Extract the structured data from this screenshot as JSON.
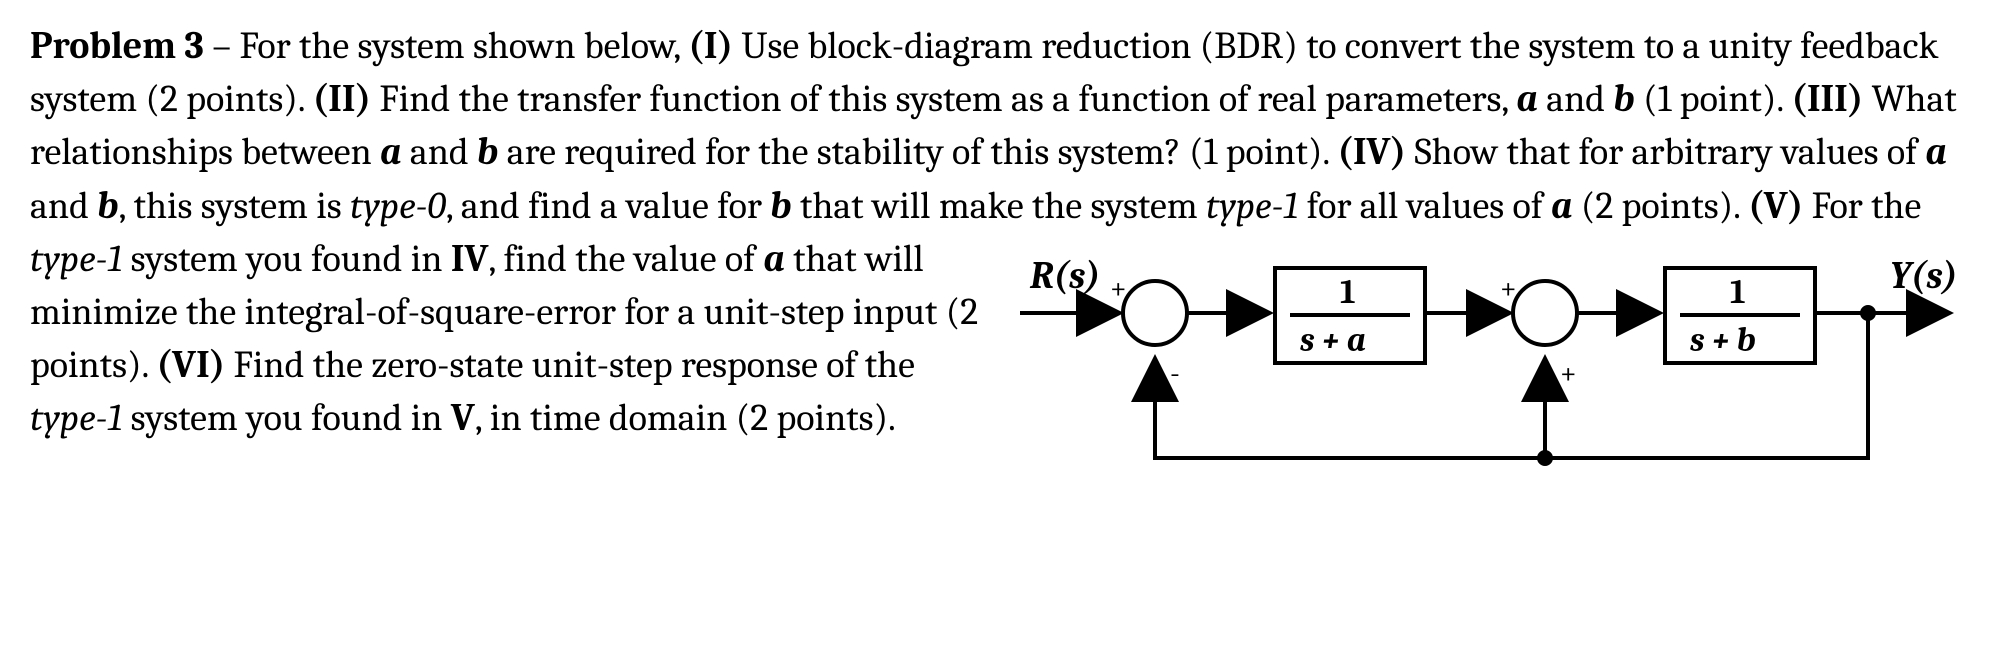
{
  "problem_label": "Problem 3",
  "sep": " – ",
  "t0": "For the system shown below, ",
  "p1_label": "(I)",
  "t1": " Use block-diagram reduction (BDR) to convert the system to a unity feedback system (2 points). ",
  "p2_label": "(II)",
  "t2a": " Find the transfer function of this system as a function of real parameters, ",
  "a": "a",
  "t2b": " and ",
  "b": "b",
  "t2c": "  (1 point). ",
  "p3_label": "(III)",
  "t3a": " What relationships between ",
  "t3b": " and ",
  "t3c": " are required for the stability of this system? (1 point). ",
  "p4_label": "(IV)",
  "t4a": " Show that for arbitrary values of ",
  "t4b": " and ",
  "t4c": ", this system is ",
  "type0": "type-0",
  "t4d": ", and find a value for ",
  "t4e": " that will make the system ",
  "type1": "type-1",
  "t4f": " for all values of ",
  "t4g": " (2 points). ",
  "p5_label": "(V)",
  "t5a": " For the ",
  "t5b": " system you found in ",
  "iv": "IV",
  "t5c": ", find the value of ",
  "t5d": " that will minimize the integral-of-square-error for a unit-step input (2 points). ",
  "p6_label": "(VI)",
  "t6a": " Find the zero-state unit-step response of the ",
  "t6b": " system you found in ",
  "v": "V",
  "t6c": ", in time domain (2 points).",
  "diagram": {
    "input": "R(s)",
    "output": "Y(s)",
    "block1_num": "1",
    "block1_den": "s + a",
    "block2_num": "1",
    "block2_den": "s + b",
    "sum1_top": "+",
    "sum1_bottom": "-",
    "sum2_top": "+",
    "sum2_bottom": "+"
  }
}
